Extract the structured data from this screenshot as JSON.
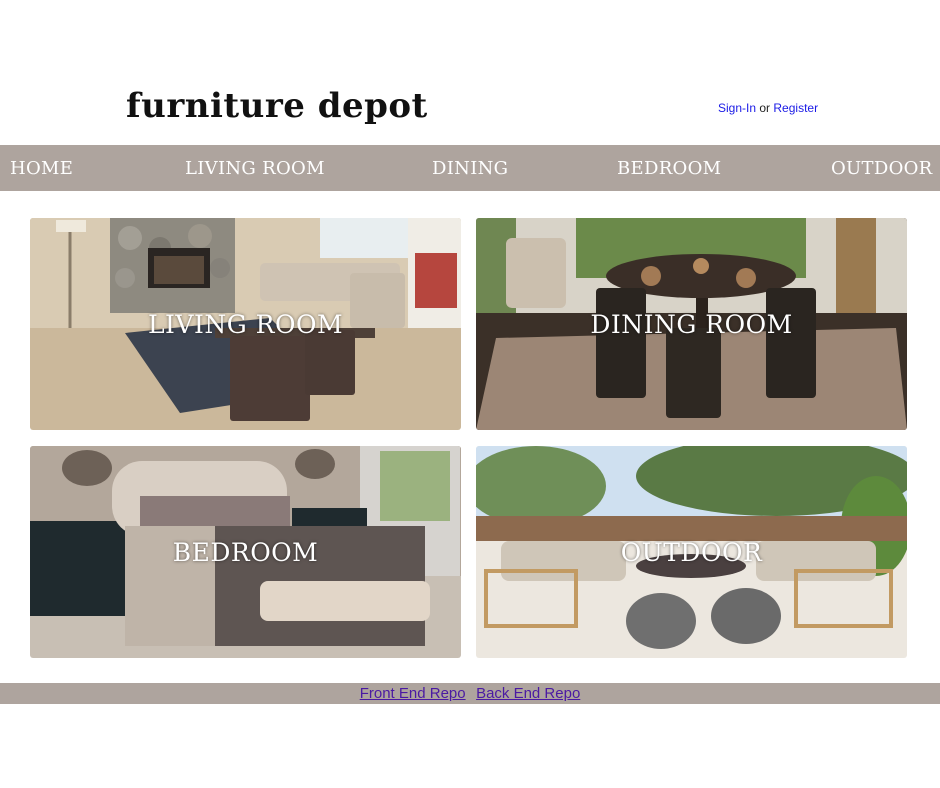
{
  "brand": {
    "logo_text": "furniture depot"
  },
  "auth": {
    "signin_label": "Sign-In",
    "separator": "or",
    "register_label": "Register",
    "link_color": "#1a1ae6"
  },
  "nav": {
    "background": "#aea49e",
    "items": [
      {
        "label": "HOME"
      },
      {
        "label": "LIVING ROOM"
      },
      {
        "label": "DINING"
      },
      {
        "label": "BEDROOM"
      },
      {
        "label": "OUTDOOR"
      }
    ]
  },
  "categories": [
    {
      "label": "LIVING ROOM"
    },
    {
      "label": "DINING ROOM"
    },
    {
      "label": "BEDROOM"
    },
    {
      "label": "OUTDOOR"
    }
  ],
  "footer": {
    "front_end_link": "Front End Repo",
    "back_end_link": "Back End Repo",
    "link_color": "#4b1aa3"
  }
}
